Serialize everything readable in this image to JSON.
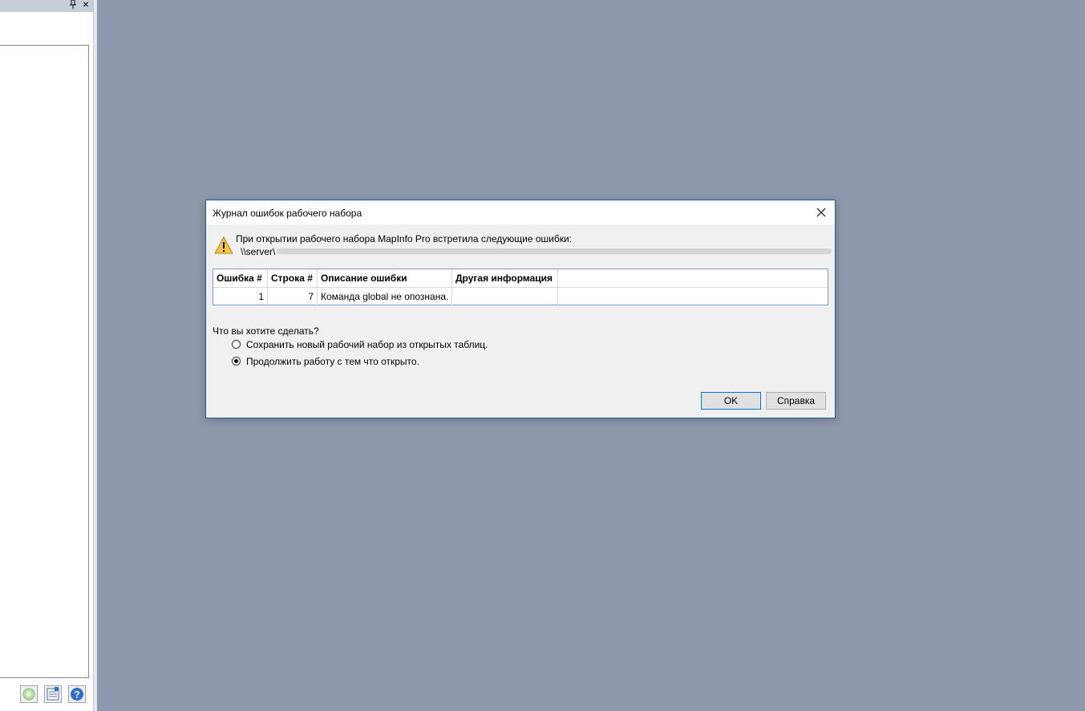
{
  "left_panel": {
    "tools": [
      {
        "icon": "refresh-icon"
      },
      {
        "icon": "layers-icon"
      },
      {
        "icon": "help-icon"
      }
    ]
  },
  "dialog": {
    "title": "Журнал ошибок рабочего набора",
    "message": "При открытии рабочего набора MapInfo Pro встретила следующие ошибки:",
    "path_prefix": "\\\\server\\",
    "error_table": {
      "columns": [
        "Ошибка #",
        "Строка #",
        "Описание ошибки",
        "Другая информация",
        ""
      ],
      "rows": [
        {
          "error_no": "1",
          "line_no": "7",
          "description": "Команда global не опознана.",
          "other": "",
          "extra": ""
        }
      ]
    },
    "question": "Что вы хотите сделать?",
    "options": [
      {
        "label": "Сохранить новый рабочий набор из открытых таблиц.",
        "selected": false
      },
      {
        "label": "Продолжить работу с тем что открыто.",
        "selected": true
      }
    ],
    "buttons": {
      "ok": "OK",
      "help": "Справка"
    }
  },
  "colors": {
    "workspace_bg": "#9098ad",
    "dialog_bg": "#f0f0f0",
    "dialog_border": "#1c5ba3",
    "accent": "#0078d7"
  }
}
